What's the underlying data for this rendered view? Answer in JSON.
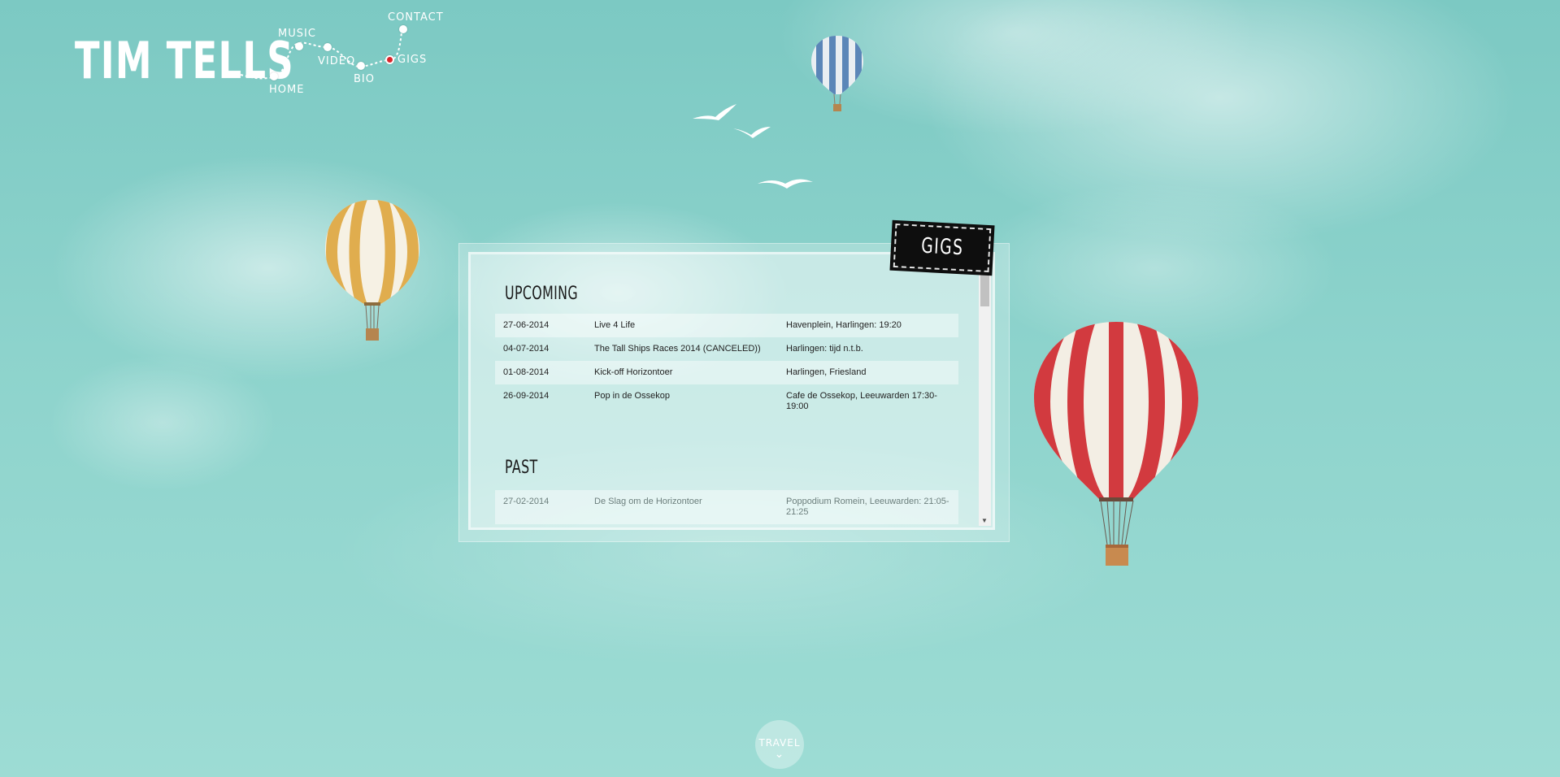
{
  "site": {
    "logo": "TIM TELLS"
  },
  "nav": {
    "items": [
      {
        "key": "home",
        "label": "HOME",
        "active": false
      },
      {
        "key": "music",
        "label": "MUSIC",
        "active": false
      },
      {
        "key": "video",
        "label": "VIDEO",
        "active": false
      },
      {
        "key": "bio",
        "label": "BIO",
        "active": false
      },
      {
        "key": "gigs",
        "label": "GIGS",
        "active": true
      },
      {
        "key": "contact",
        "label": "CONTACT",
        "active": false
      }
    ],
    "active_color": "#d9262b"
  },
  "panel": {
    "badge": "GIGS",
    "upcoming_title": "UPCOMING",
    "past_title": "PAST",
    "upcoming": [
      {
        "date": "27-06-2014",
        "name": "Live 4 Life",
        "location": "Havenplein, Harlingen: 19:20"
      },
      {
        "date": "04-07-2014",
        "name": "The Tall Ships Races 2014 (CANCELED))",
        "location": "Harlingen: tijd n.t.b."
      },
      {
        "date": "01-08-2014",
        "name": "Kick-off Horizontoer",
        "location": "Harlingen, Friesland"
      },
      {
        "date": "26-09-2014",
        "name": "Pop in de Ossekop",
        "location": "Cafe de Ossekop, Leeuwarden 17:30-19:00"
      }
    ],
    "past": [
      {
        "date": "27-02-2014",
        "name": "De Slag om de Horizontoer",
        "location": "Poppodium Romein, Leeuwarden: 21:05-21:25"
      }
    ]
  },
  "travel": {
    "label": "TRAVEL"
  },
  "decorations": {
    "balloons": [
      "yellow-striped",
      "red-striped",
      "blue-striped"
    ],
    "colors": {
      "sky": "#8dd3cc",
      "balloon_red": "#d23a3f",
      "balloon_yellow": "#e0ad4e",
      "balloon_blue": "#5b86b8"
    }
  }
}
